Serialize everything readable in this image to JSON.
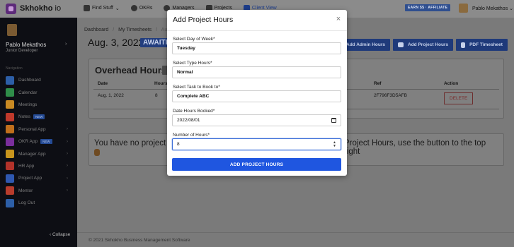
{
  "app": {
    "name": "Skhokho",
    "name_suffix": "io"
  },
  "top_nav": [
    {
      "label": "Find Stuff",
      "icon": "grid-icon"
    },
    {
      "label": "OKRs",
      "icon": "target-icon"
    },
    {
      "label": "Managers",
      "icon": "user-circle-icon"
    },
    {
      "label": "Projects",
      "icon": "folder-icon"
    },
    {
      "label": "Client View",
      "icon": "eye-icon"
    }
  ],
  "earn_badge": "EARN $$ · AFFILIATE",
  "user": {
    "name": "Pablo Mekathos",
    "top_name": "Pablo Mekathos",
    "role": "Junior Developer"
  },
  "sidebar": {
    "nav_title": "Navigation",
    "items": [
      {
        "label": "Dashboard",
        "color": "#2d5fa8",
        "has_chevron": false,
        "badge": ""
      },
      {
        "label": "Calendar",
        "color": "#2f8d49",
        "has_chevron": false,
        "badge": ""
      },
      {
        "label": "Meetings",
        "color": "#c98a23",
        "has_chevron": false,
        "badge": ""
      },
      {
        "label": "Notes",
        "color": "#c0392b",
        "has_chevron": false,
        "badge": "NEW"
      },
      {
        "label": "Personal App",
        "color": "#c06f1c",
        "has_chevron": true,
        "badge": ""
      },
      {
        "label": "OKR App",
        "color": "#7a2e9c",
        "has_chevron": true,
        "badge": "NEW"
      },
      {
        "label": "Manager App",
        "color": "#c8951d",
        "has_chevron": true,
        "badge": ""
      },
      {
        "label": "HR App",
        "color": "#b2322a",
        "has_chevron": true,
        "badge": ""
      },
      {
        "label": "Project App",
        "color": "#2f58b0",
        "has_chevron": true,
        "badge": ""
      },
      {
        "label": "Mentor",
        "color": "#b83c2c",
        "has_chevron": true,
        "badge": ""
      },
      {
        "label": "Log Out",
        "color": "#2d5fa8",
        "has_chevron": false,
        "badge": ""
      }
    ],
    "collapse_label": "Collapse"
  },
  "breadcrumb": [
    "Dashboard",
    "/",
    "My Timesheets",
    "/",
    "Aug. 3,"
  ],
  "page": {
    "date_title": "Aug. 3, 2022",
    "status": "AWAITIN"
  },
  "actions": [
    {
      "label": "Add Admin Hours",
      "icon": ""
    },
    {
      "label": "Add Project Hours",
      "icon": "briefcase-icon"
    },
    {
      "label": "PDF Timesheet",
      "icon": "file-icon"
    }
  ],
  "overhead": {
    "title": "Overhead Hours",
    "count": "",
    "headers": {
      "date": "Date",
      "hours": "Hours",
      "ref": "Ref",
      "action": "Action"
    },
    "row": {
      "date": "Aug. 1, 2022",
      "hours": "8",
      "ref": "2F796F3D5AFB",
      "action": "DELETE"
    }
  },
  "empty_state": {
    "left": "You have no project h",
    "right": "Project Hours, use the button to the top right"
  },
  "footer": "© 2021 Skhokho Business Management Software",
  "modal": {
    "title": "Add Project Hours",
    "fields": {
      "day": {
        "label": "Select Day of Week*",
        "value": "Tuesday"
      },
      "type": {
        "label": "Select Type Hours*",
        "value": "Normal"
      },
      "task": {
        "label": "Select Task to Book to*",
        "value": "Complete ABC"
      },
      "date": {
        "label": "Date Hours Booked*",
        "value": "2022/08/01"
      },
      "hours": {
        "label": "Number of Hours*",
        "value": "8"
      }
    },
    "submit_label": "ADD PROJECT HOURS"
  }
}
